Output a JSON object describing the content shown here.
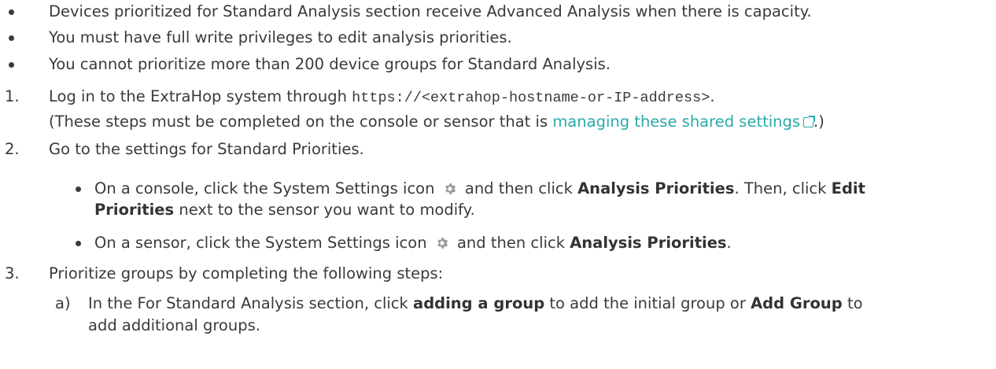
{
  "bullets": [
    "Devices prioritized for Standard Analysis section receive Advanced Analysis when there is capacity.",
    "You must have full write privileges to edit analysis priorities.",
    "You cannot prioritize more than 200 device groups for Standard Analysis."
  ],
  "step1": {
    "num": "1.",
    "prefix": "Log in to the ExtraHop system through",
    "url": "https://<extrahop-hostname-or-IP-address>",
    "period": ".",
    "note_open": "(These steps must be completed on the console or sensor that is",
    "link": "managing these shared settings",
    "note_close": ".)"
  },
  "step2": {
    "num": "2.",
    "text": "Go to the settings for Standard Priorities.",
    "console": {
      "a": "On a console, click the System Settings icon",
      "b": "and then click",
      "bold1": "Analysis Priorities",
      "c": ". Then, click",
      "bold2a": "Edit",
      "bold2b": "Priorities",
      "d": "next to the sensor you want to modify."
    },
    "sensor": {
      "a": "On a sensor, click the System Settings icon",
      "b": "and then click",
      "bold": "Analysis Priorities",
      "c": "."
    }
  },
  "step3": {
    "num": "3.",
    "text": "Prioritize groups by completing the following steps:",
    "sub_a": {
      "letter": "a)",
      "a": "In the For Standard Analysis section, click",
      "bold1": "adding a group",
      "b": "to add the initial group or",
      "bold2": "Add Group",
      "c": "to",
      "line2": "add additional groups."
    }
  },
  "colors": {
    "text": "#3a3a3a",
    "link": "#2aa9a9",
    "gear": "#9a9a9a"
  }
}
